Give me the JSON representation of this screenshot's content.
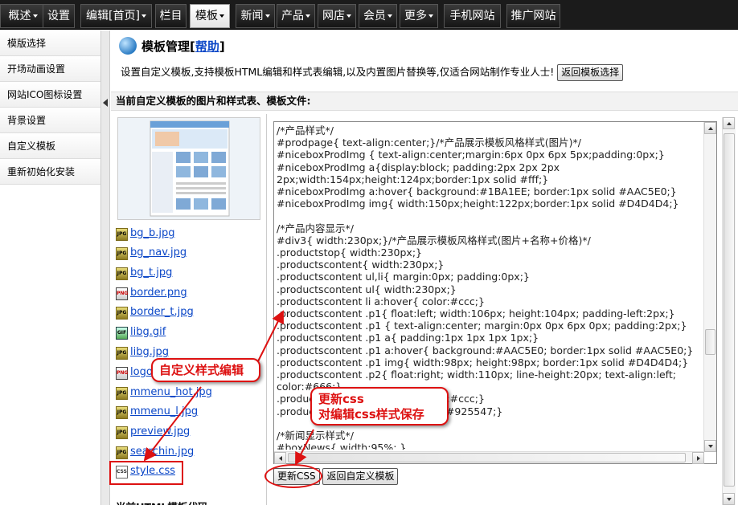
{
  "topnav": {
    "items": [
      {
        "label": "概述",
        "dropdown": true
      },
      {
        "label": "设置",
        "dropdown": false
      },
      {
        "label": "编辑[首页]",
        "dropdown": true
      },
      {
        "label": "栏目",
        "dropdown": false
      },
      {
        "label": "模板",
        "dropdown": true,
        "active": true
      },
      {
        "label": "新闻",
        "dropdown": true
      },
      {
        "label": "产品",
        "dropdown": true
      },
      {
        "label": "网店",
        "dropdown": true
      },
      {
        "label": "会员",
        "dropdown": true
      },
      {
        "label": "更多",
        "dropdown": true
      },
      {
        "label": "手机网站",
        "dropdown": false
      },
      {
        "label": "推广网站",
        "dropdown": false
      }
    ]
  },
  "sidebar": {
    "items": [
      {
        "label": "模版选择"
      },
      {
        "label": "开场动画设置"
      },
      {
        "label": "网站ICO图标设置"
      },
      {
        "label": "背景设置"
      },
      {
        "label": "自定义模板"
      },
      {
        "label": "重新初始化安装"
      }
    ]
  },
  "main": {
    "title": "模板管理",
    "title_bracket_open": "[",
    "help_link": "帮助",
    "title_bracket_close": "]",
    "description": "设置自定义模板,支持模板HTML编辑和样式表编辑,以及内置图片替换等,仅适合网站制作专业人士!",
    "back_to_templates_button": "返回模板选择",
    "section_title": "当前自定义模板的图片和样式表、模板文件:",
    "files": [
      {
        "name": "bg_b.jpg",
        "type": "JPG"
      },
      {
        "name": "bg_nav.jpg",
        "type": "JPG"
      },
      {
        "name": "bg_t.jpg",
        "type": "JPG"
      },
      {
        "name": "border.png",
        "type": "PNG"
      },
      {
        "name": "border_t.jpg",
        "type": "JPG"
      },
      {
        "name": "libg.gif",
        "type": "GIF"
      },
      {
        "name": "libg.jpg",
        "type": "JPG"
      },
      {
        "name": "logo.png",
        "type": "PNG"
      },
      {
        "name": "mmenu_hot.jpg",
        "type": "JPG"
      },
      {
        "name": "mmenu_l.jpg",
        "type": "JPG"
      },
      {
        "name": "preview.jpg",
        "type": "JPG"
      },
      {
        "name": "searchin.jpg",
        "type": "JPG"
      },
      {
        "name": "style.css",
        "type": "CSS"
      }
    ],
    "css_code": "/*产品样式*/\n#prodpage{ text-align:center;}/*产品展示模板风格样式(图片)*/\n#niceboxProdImg { text-align:center;margin:6px 0px 6px 5px;padding:0px;}\n#niceboxProdImg a{display:block; padding:2px 2px 2px\n2px;width:154px;height:124px;border:1px solid #fff;}\n#niceboxProdImg a:hover{ background:#1BA1EE; border:1px solid #AAC5E0;}\n#niceboxProdImg img{ width:150px;height:122px;border:1px solid #D4D4D4;}\n\n/*产品内容显示*/\n#div3{ width:230px;}/*产品展示模板风格样式(图片+名称+价格)*/\n.productstop{ width:230px;}\n.productscontent{ width:230px;}\n.productscontent ul,li{ margin:0px; padding:0px;}\n.productscontent ul{ width:230px;}\n.productscontent li a:hover{ color:#ccc;}\n.productscontent .p1{ float:left; width:106px; height:104px; padding-left:2px;}\n.productscontent .p1 { text-align:center; margin:0px 0px 6px 0px; padding:2px;}\n.productscontent .p1 a{ padding:1px 1px 1px 1px;}\n.productscontent .p1 a:hover{ background:#AAC5E0; border:1px solid #AAC5E0;}\n.productscontent .p1 img{ width:98px; height:98px; border:1px solid #D4D4D4;}\n.productscontent .p2{ float:right; width:110px; line-height:20px; text-align:left;\ncolor:#666;}\n.productscontent li a:hover{ color:#ccc;}\n.productscontent .p2 span{ color:#925547;}\n\n/*新闻显示样式*/\n#boxNews{ width:95%; }",
    "update_css_button": "更新CSS",
    "back_to_custom_button": "返回自定义模板",
    "bottom_label": "当前HTML模板代码:"
  },
  "annotations": {
    "callout_edit": "自定义样式编辑",
    "callout_update_line1": "更新css",
    "callout_update_line2": "对编辑css样式保存",
    "accent_color": "#dd1111"
  }
}
